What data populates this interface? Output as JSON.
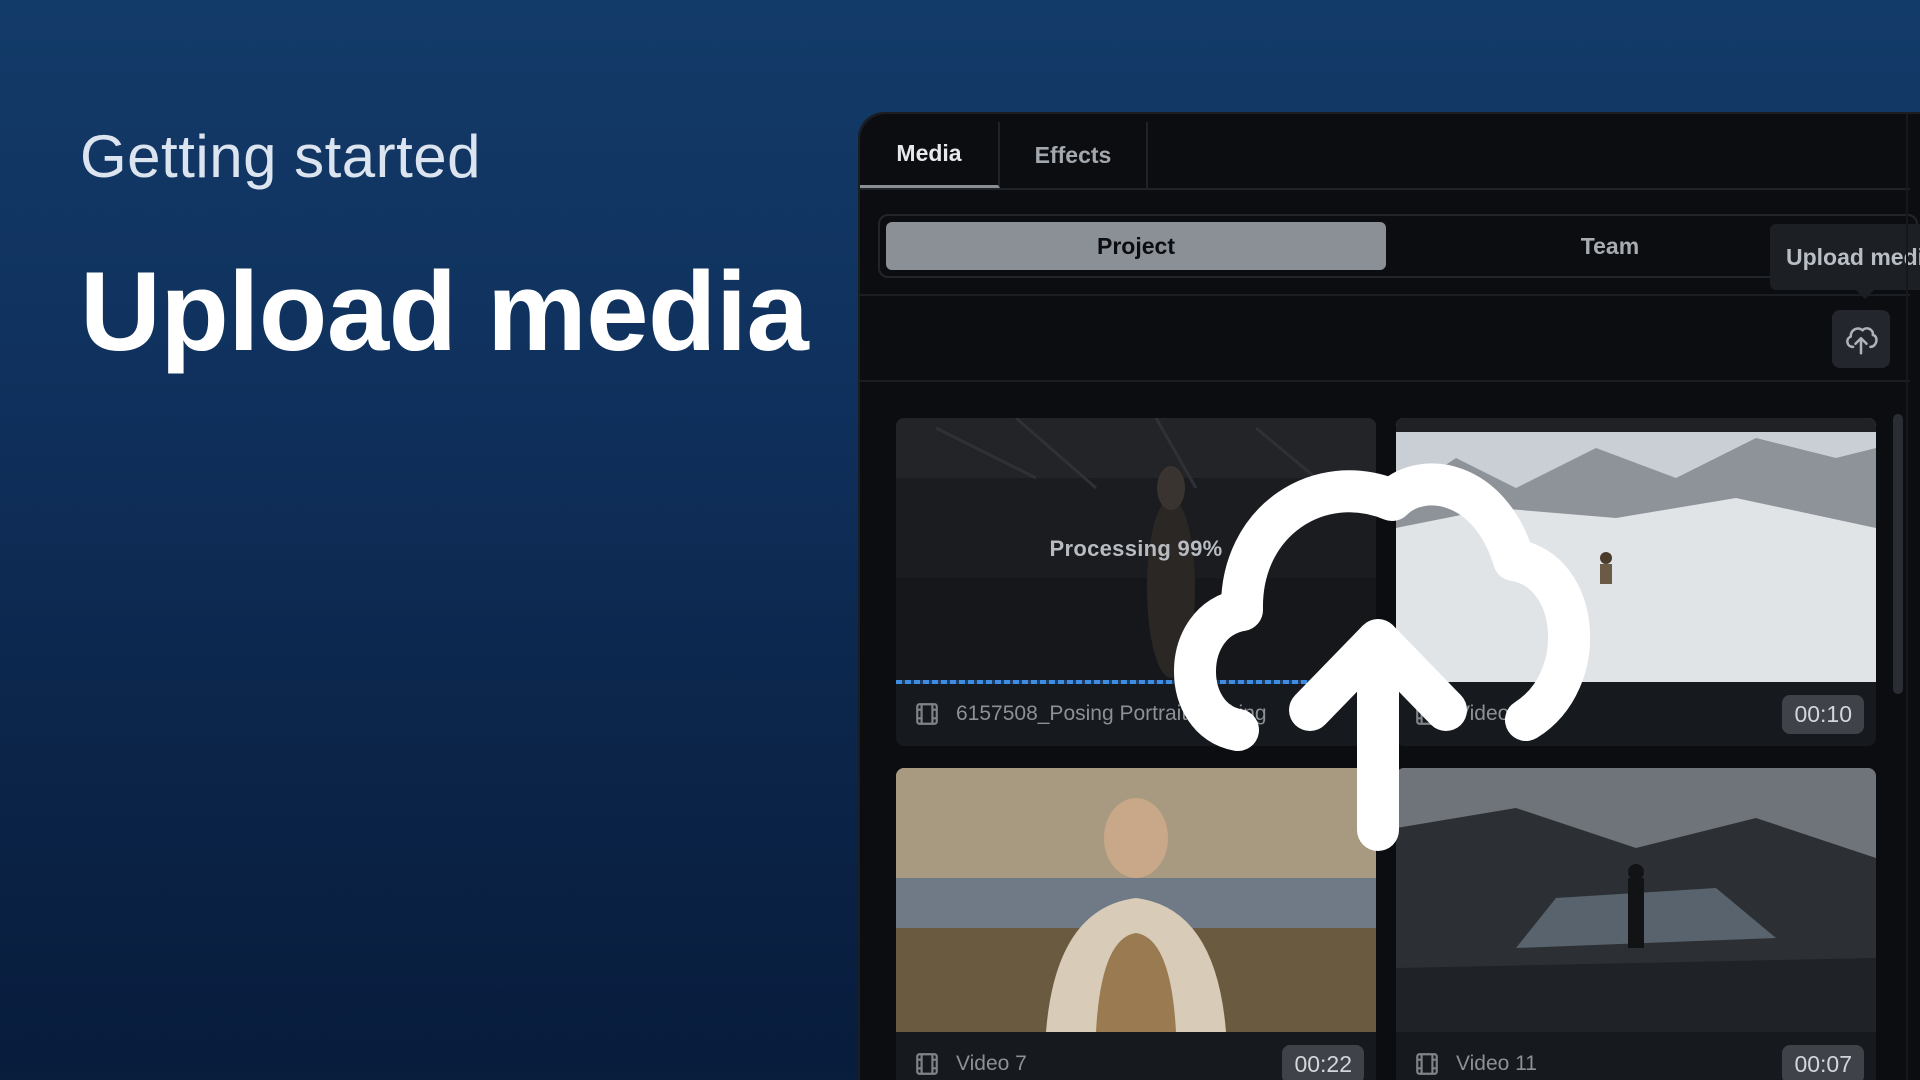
{
  "hero": {
    "eyebrow": "Getting started",
    "headline": "Upload media"
  },
  "panel": {
    "tabs": [
      {
        "label": "Media",
        "active": true
      },
      {
        "label": "Effects",
        "active": false
      }
    ],
    "segment": {
      "project_label": "Project",
      "team_label": "Team",
      "selected": "Project"
    },
    "tooltip": "Upload media",
    "upload_button_icon": "cloud-upload-icon",
    "cards": [
      {
        "name": "6157508_Posing Portrait Looking",
        "status": "Processing 99%",
        "progress": 0.99,
        "duration": ""
      },
      {
        "name": "Video 10",
        "status": "",
        "duration": "00:10"
      },
      {
        "name": "Video 7",
        "status": "",
        "duration": "00:22"
      },
      {
        "name": "Video 11",
        "status": "",
        "duration": "00:07"
      }
    ]
  },
  "overlay_icon": "cloud-upload-icon",
  "colors": {
    "background_top": "#133b69",
    "background_bottom": "#081c3c",
    "panel_bg": "#0b0d10",
    "progress_accent": "#3f8ce0",
    "selected_segment": "#8b9097"
  }
}
